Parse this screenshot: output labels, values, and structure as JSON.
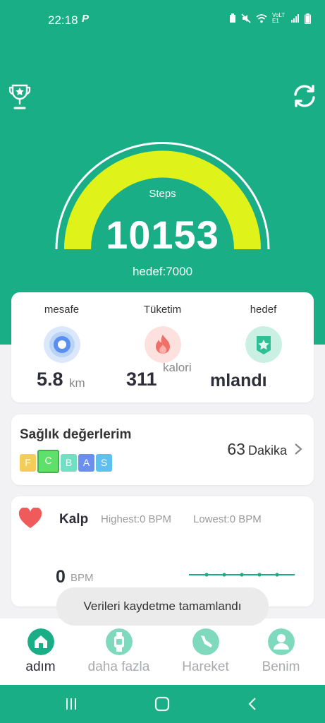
{
  "status_bar": {
    "time": "22:18",
    "app_badge": "P",
    "icons": [
      "battery-saver-icon",
      "mute-icon",
      "wifi-icon",
      "volte-icon",
      "signal-icon",
      "battery-icon"
    ],
    "volte": "VoLTE1"
  },
  "header": {
    "steps_label": "Steps",
    "steps_value": "10153",
    "goal_text": "hedef:7000",
    "progress": 1.0
  },
  "stats": {
    "distance": {
      "label": "mesafe",
      "value": "5.8",
      "unit": "km"
    },
    "consumption": {
      "label": "Tüketim",
      "value": "311",
      "unit": "kalori"
    },
    "goal": {
      "label": "hedef",
      "value": "mlandı"
    }
  },
  "health": {
    "title": "Sağlık değerlerim",
    "grades": [
      "F",
      "C",
      "B",
      "A",
      "S"
    ],
    "minutes_value": "63",
    "minutes_unit": "Dakika"
  },
  "heart": {
    "title": "Kalp",
    "highest": "Highest:0  BPM",
    "lowest": "Lowest:0  BPM",
    "bpm_value": "0",
    "bpm_unit": "BPM"
  },
  "toast": "Verileri kaydetme tamamlandı",
  "tabs": [
    {
      "label": "adım",
      "active": true
    },
    {
      "label": "daha fazla",
      "active": false
    },
    {
      "label": "Hareket",
      "active": false
    },
    {
      "label": "Benim",
      "active": false
    }
  ],
  "colors": {
    "brand_green": "#1aae86",
    "gauge_yellow": "#dff21a",
    "text_dark": "#2e2e3a"
  }
}
